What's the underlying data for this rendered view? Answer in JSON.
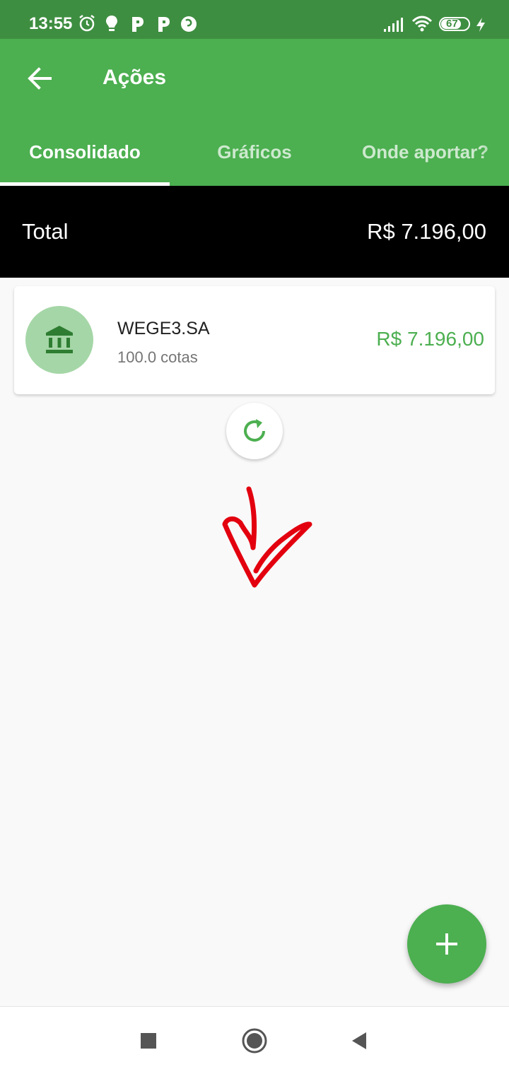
{
  "status_bar": {
    "time": "13:55",
    "battery": "67",
    "icons": [
      "alarm-icon",
      "bulb-icon",
      "p-app-icon",
      "p-app-icon",
      "firefox-icon",
      "signal-icon",
      "wifi-icon",
      "battery-icon",
      "charging-icon"
    ]
  },
  "app_bar": {
    "title": "Ações",
    "back_icon": "arrow-left-icon"
  },
  "tabs": [
    {
      "label": "Consolidado",
      "active": true
    },
    {
      "label": "Gráficos",
      "active": false
    },
    {
      "label": "Onde aportar?",
      "active": false
    }
  ],
  "summary": {
    "label": "Total",
    "value": "R$ 7.196,00"
  },
  "holdings": [
    {
      "ticker": "WEGE3.SA",
      "quantity": "100.0 cotas",
      "value": "R$ 7.196,00",
      "icon": "bank-icon"
    }
  ],
  "actions": {
    "refresh_icon": "refresh-icon",
    "fab_icon": "plus-icon"
  },
  "nav": [
    "recents-square-icon",
    "home-circle-icon",
    "back-triangle-icon"
  ],
  "colors": {
    "primary": "#4caf50",
    "status_bar": "#3e8e41",
    "avatar_bg": "#a5d6a7",
    "value_green": "#4caf50",
    "annotation_red": "#e3000f"
  }
}
